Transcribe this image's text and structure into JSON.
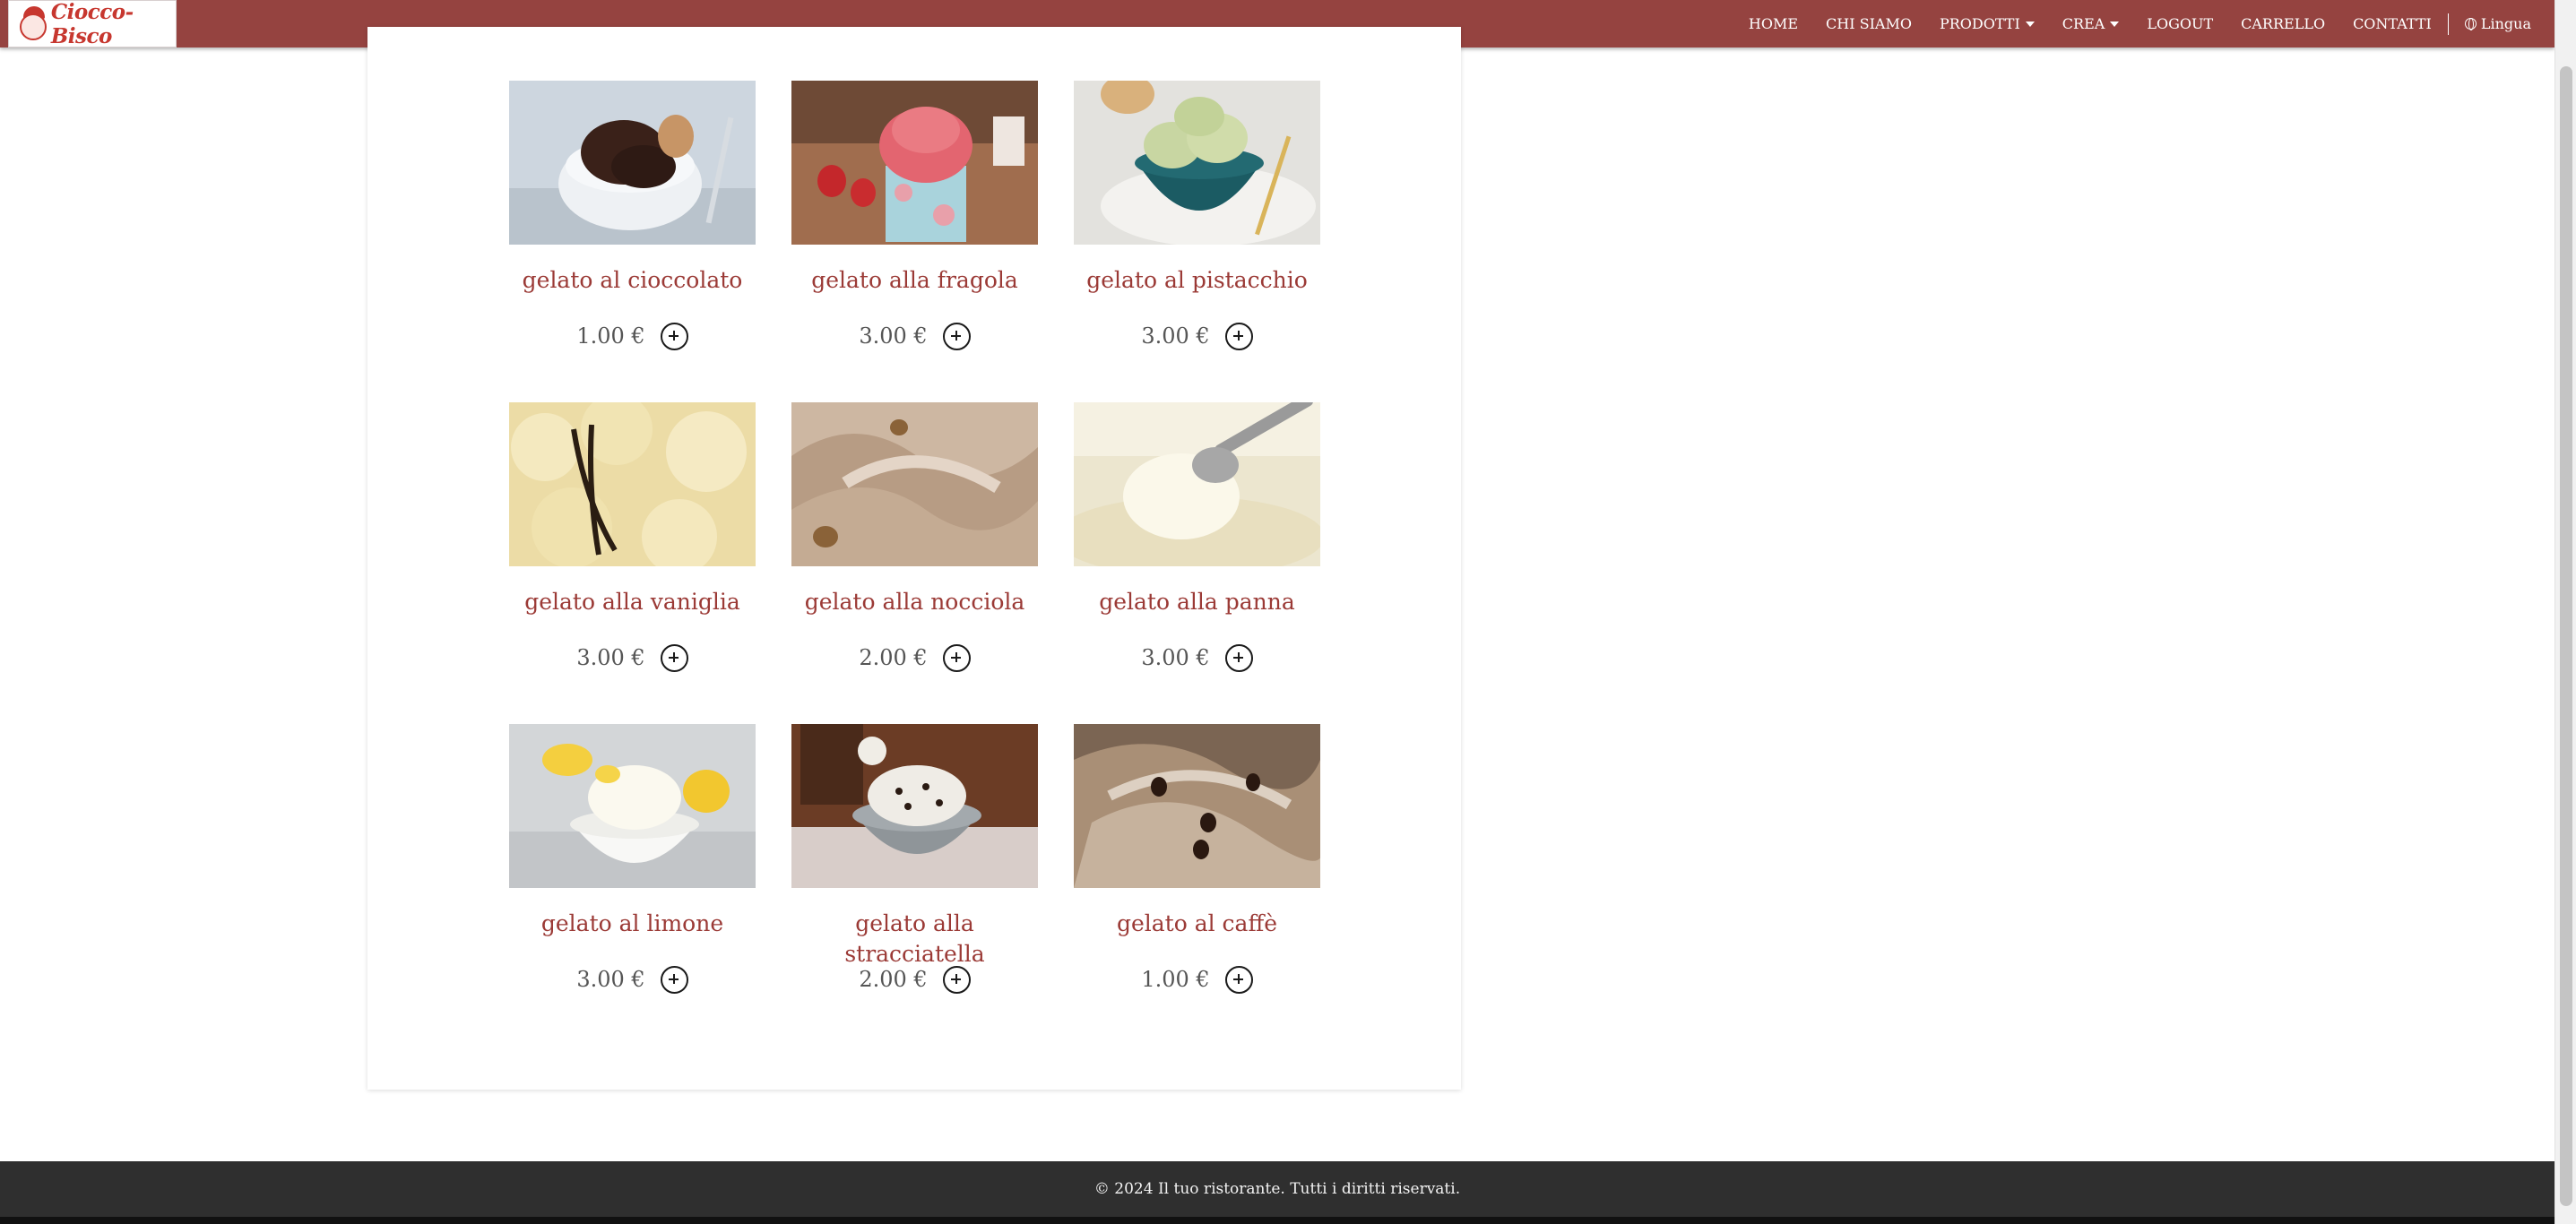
{
  "brand": {
    "name": "Ciocco-Bisco"
  },
  "nav": {
    "home": "HOME",
    "about": "CHI SIAMO",
    "products": "PRODOTTI",
    "create": "CREA",
    "logout": "LOGOUT",
    "cart": "CARRELLO",
    "contacts": "CONTATTI",
    "language": "Lingua"
  },
  "products": [
    {
      "name": "gelato al cioccolato",
      "price": "1.00 €"
    },
    {
      "name": "gelato alla fragola",
      "price": "3.00 €"
    },
    {
      "name": "gelato al pistacchio",
      "price": "3.00 €"
    },
    {
      "name": "gelato alla vaniglia",
      "price": "3.00 €"
    },
    {
      "name": "gelato alla nocciola",
      "price": "2.00 €"
    },
    {
      "name": "gelato alla panna",
      "price": "3.00 €"
    },
    {
      "name": "gelato al limone",
      "price": "3.00 €"
    },
    {
      "name": "gelato alla stracciatella",
      "price": "2.00 €"
    },
    {
      "name": "gelato al caffè",
      "price": "1.00 €"
    }
  ],
  "footer": {
    "text": "© 2024 Il tuo ristorante. Tutti i diritti riservati."
  },
  "colors": {
    "navbar": "#954340",
    "accent_text": "#9b3a36",
    "footer": "#2f2f2f"
  }
}
